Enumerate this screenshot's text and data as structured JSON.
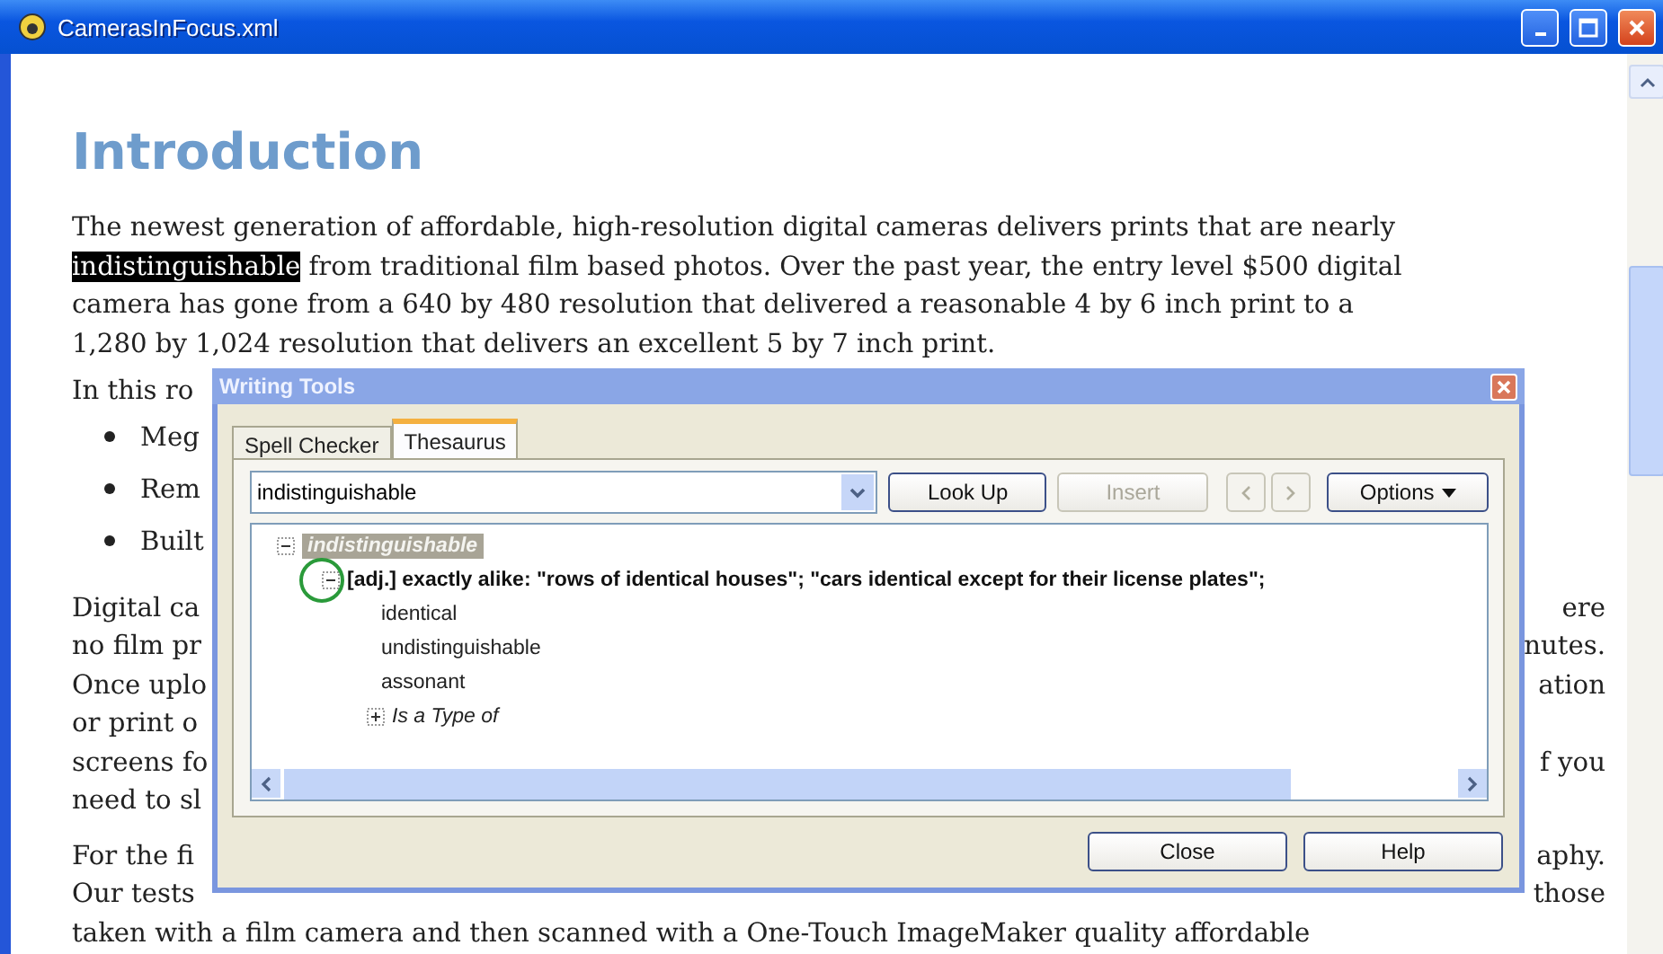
{
  "window": {
    "title": "CamerasInFocus.xml"
  },
  "document": {
    "heading": "Introduction",
    "lines": [
      {
        "kind": "full",
        "segments": [
          {
            "text": "The newest generation of affordable, high-resolution digital cameras delivers prints that are nearly",
            "selected": false
          }
        ]
      },
      {
        "kind": "full",
        "segments": [
          {
            "text": "indistinguishable",
            "selected": true
          },
          {
            "text": " from traditional film based photos. Over the past year, the entry level $500 digital",
            "selected": false
          }
        ]
      },
      {
        "kind": "full",
        "segments": [
          {
            "text": "camera has gone from a 640 by 480 resolution that delivered a reasonable 4 by 6 inch print to a",
            "selected": false
          }
        ]
      },
      {
        "kind": "full",
        "segments": [
          {
            "text": "1,280 by 1,024 resolution that delivers an excellent 5 by 7 inch print.",
            "selected": false
          }
        ]
      },
      {
        "kind": "split",
        "left": "In this ro"
      },
      {
        "kind": "bullet",
        "left": "Meg"
      },
      {
        "kind": "bullet",
        "left": "Rem"
      },
      {
        "kind": "bullet",
        "left": "Built"
      },
      {
        "kind": "split",
        "left": "Digital ca",
        "right": "ere"
      },
      {
        "kind": "split",
        "left": "no film pr",
        "right": "nutes."
      },
      {
        "kind": "split",
        "left": "Once uplo",
        "right": "ation"
      },
      {
        "kind": "split",
        "left": "or print o"
      },
      {
        "kind": "split",
        "left": "screens fo",
        "right": "f you"
      },
      {
        "kind": "split",
        "left": "need to sl"
      },
      {
        "kind": "split",
        "left": "For the fi",
        "right": "aphy."
      },
      {
        "kind": "split",
        "left": "Our tests",
        "right": "those"
      },
      {
        "kind": "full",
        "segments": [
          {
            "text": "taken with a film camera and then scanned with a One-Touch ImageMaker quality affordable",
            "selected": false
          }
        ]
      }
    ]
  },
  "dialog": {
    "title": "Writing Tools",
    "tabs": [
      {
        "label": "Spell Checker",
        "selected": false
      },
      {
        "label": "Thesaurus",
        "selected": true
      }
    ],
    "word_field": {
      "value": "indistinguishable"
    },
    "buttons": [
      {
        "label": "Look Up",
        "disabled": false
      },
      {
        "label": "Insert",
        "disabled": true
      }
    ],
    "options_button": "Options",
    "tree": [
      {
        "label": "indistinguishable",
        "kind": "word",
        "selected": true,
        "expanded": true,
        "children": [
          {
            "label": "[adj.] exactly alike: \"rows of identical houses\"; \"cars identical except for their license plates\";",
            "kind": "sense",
            "selected": false,
            "expanded": true,
            "children": [
              {
                "label": "identical",
                "kind": "synonym",
                "selected": false
              },
              {
                "label": "undistinguishable",
                "kind": "synonym",
                "selected": false
              },
              {
                "label": "assonant",
                "kind": "synonym",
                "selected": false
              },
              {
                "label": "Is a Type of",
                "kind": "relation",
                "selected": false,
                "expanded": false
              }
            ]
          }
        ]
      }
    ],
    "footer_buttons": [
      "Close",
      "Help"
    ]
  }
}
